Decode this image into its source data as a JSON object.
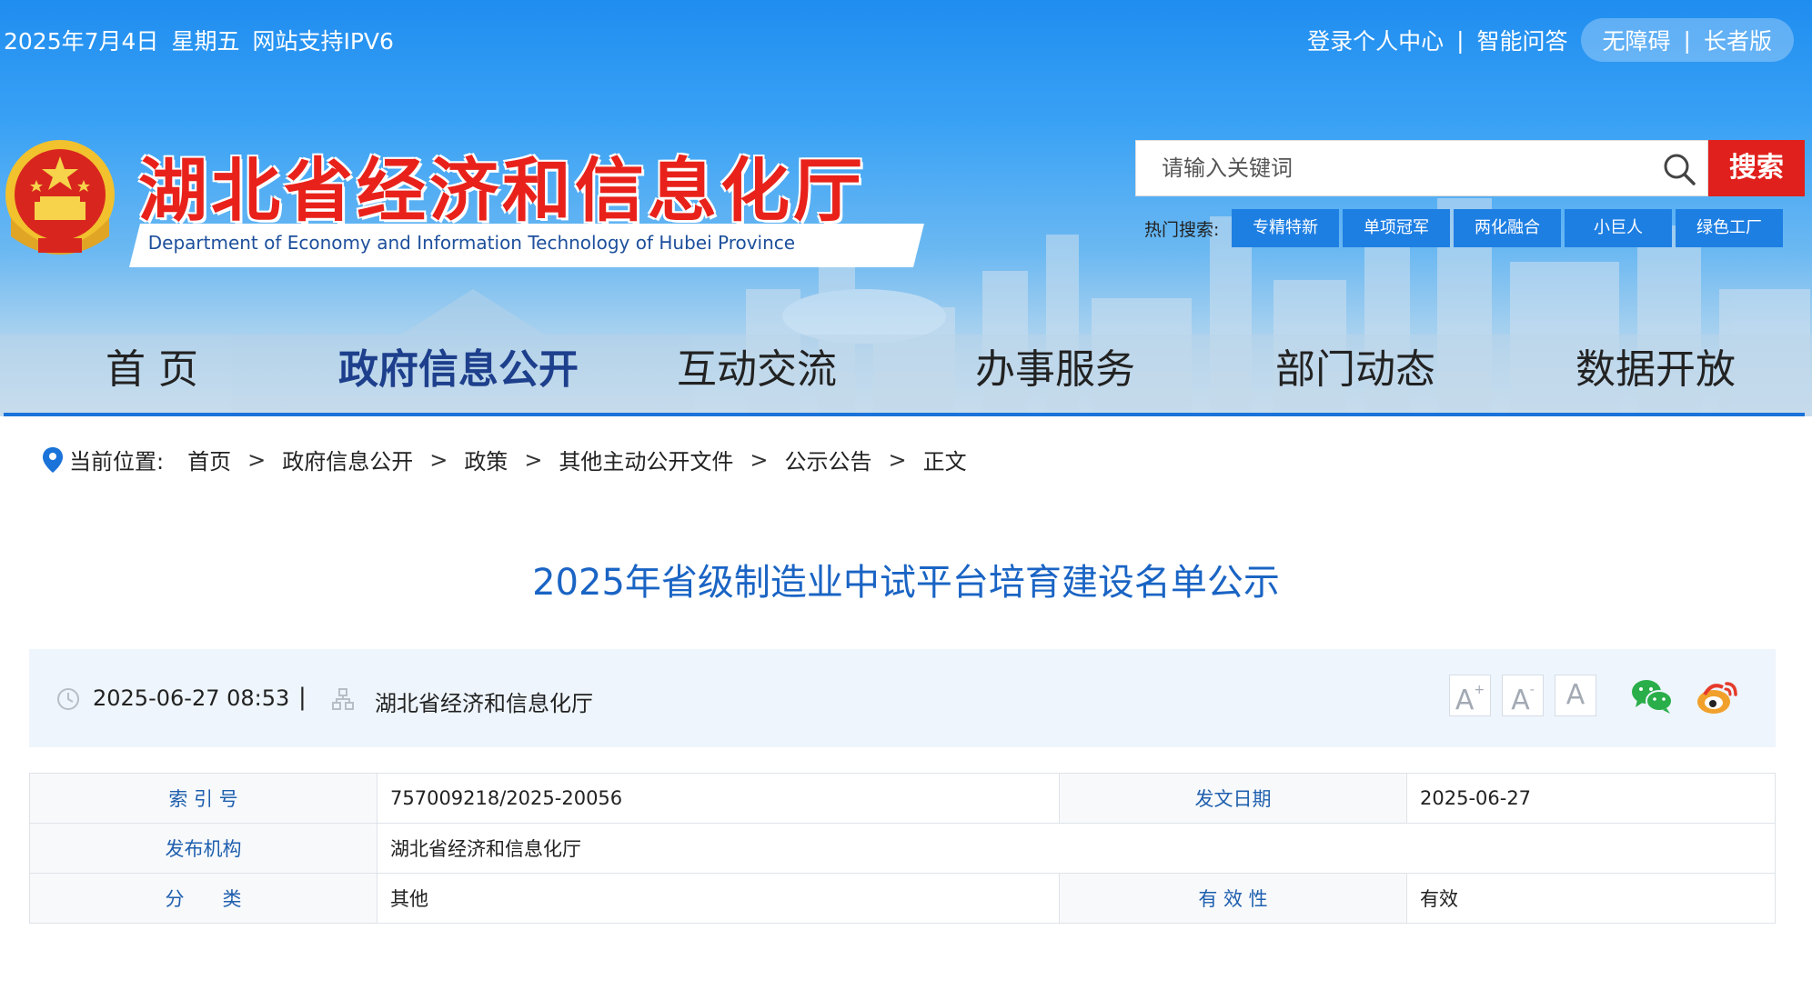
{
  "topbar": {
    "date": "2025年7月4日",
    "weekday": "星期五",
    "ipv6": "网站支持IPV6",
    "login": "登录个人中心",
    "sep": "|",
    "qa": "智能问答",
    "accessible": "无障碍",
    "elder": "长者版"
  },
  "site": {
    "title": "湖北省经济和信息化厅",
    "subtitle": "Department of Economy and Information Technology of Hubei Province"
  },
  "search": {
    "placeholder": "请输入关键词",
    "button": "搜索",
    "hot_label": "热门搜索:",
    "hot_tags": [
      "专精特新",
      "单项冠军",
      "两化融合",
      "小巨人",
      "绿色工厂"
    ]
  },
  "nav": [
    "首 页",
    "政府信息公开",
    "互动交流",
    "办事服务",
    "部门动态",
    "数据开放"
  ],
  "breadcrumb": {
    "label": "当前位置:",
    "items": [
      "首页",
      "政府信息公开",
      "政策",
      "其他主动公开文件",
      "公示公告",
      "正文"
    ],
    "arrow": ">"
  },
  "article": {
    "title": "2025年省级制造业中试平台培育建设名单公示",
    "datetime": "2025-06-27 08:53",
    "divider": "|",
    "publisher": "湖北省经济和信息化厅",
    "font_sizes": [
      "A",
      "A",
      "A"
    ]
  },
  "info": {
    "index_label": "索 引 号",
    "index_value": "757009218/2025-20056",
    "date_label": "发文日期",
    "date_value": "2025-06-27",
    "org_label": "发布机构",
    "org_value": "湖北省经济和信息化厅",
    "category_label": "分　　类",
    "category_value": "其他",
    "validity_label": "有 效 性",
    "validity_value": "有效"
  },
  "colors": {
    "brand_red": "#e8221b",
    "nav_blue": "#1a73d9",
    "title_blue": "#1a64c4",
    "hot_tag": "#1e7fe3"
  },
  "icons": [
    "emblem-icon",
    "search-icon",
    "location-pin-icon",
    "clock-icon",
    "org-icon",
    "wechat-icon",
    "weibo-icon"
  ]
}
